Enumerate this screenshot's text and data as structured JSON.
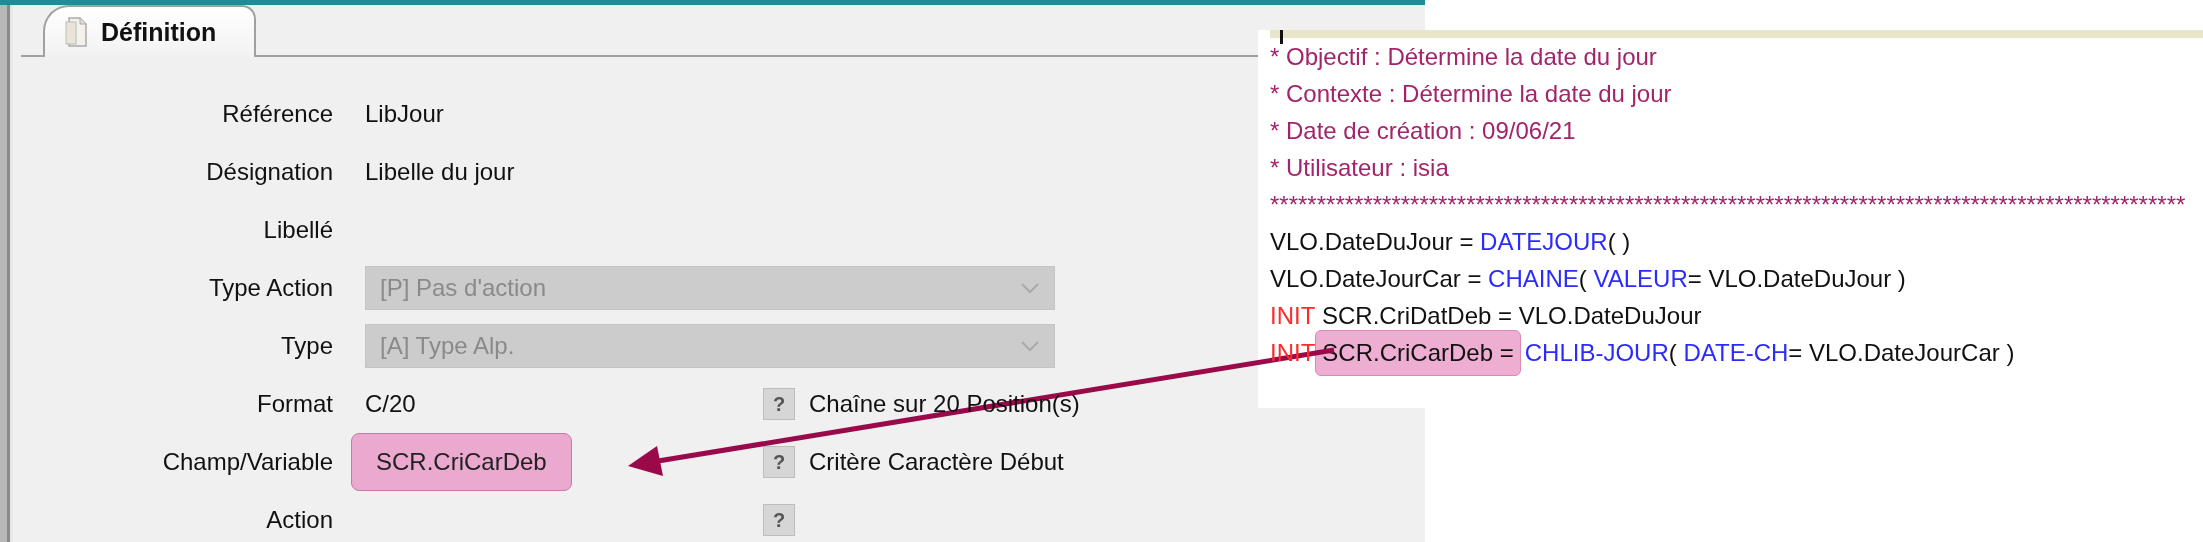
{
  "tab": {
    "label": "Définition",
    "selected": true
  },
  "form": [
    {
      "label": "Référence",
      "kind": "text",
      "value": "LibJour"
    },
    {
      "label": "Désignation",
      "kind": "text",
      "value": "Libelle du jour"
    },
    {
      "label": "Libellé",
      "kind": "text"
    },
    {
      "label": "Type Action",
      "kind": "dropdown",
      "value": "[P] Pas d'action",
      "disabled": true
    },
    {
      "label": "Type",
      "kind": "dropdown",
      "value": "[A] Type Alp.",
      "disabled": true
    },
    {
      "label": "Format",
      "kind": "text",
      "value": "C/20",
      "help": {
        "icon": "?",
        "text": "Chaîne sur 20 Position(s)"
      }
    },
    {
      "label": "Champ/Variable",
      "kind": "text",
      "value": "SCR.CriCarDeb",
      "highlighted": true,
      "help": {
        "icon": "?",
        "text": "Critère Caractère Début"
      }
    },
    {
      "label": "Action",
      "kind": "text",
      "help": {
        "icon": "?"
      }
    }
  ],
  "code": [
    [
      {
        "kind": "comment",
        "text": "* Objectif : Détermine la date du jour"
      }
    ],
    [
      {
        "kind": "comment",
        "text": "* Contexte : Détermine la date du jour"
      }
    ],
    [
      {
        "kind": "comment",
        "text": "* Date de création : 09/06/21"
      }
    ],
    [
      {
        "kind": "comment",
        "text": "* Utilisateur : isia"
      }
    ],
    [
      {
        "kind": "comment",
        "text": "**************************************************************************************************"
      }
    ],
    [
      {
        "kind": "plain",
        "text": "VLO.DateDuJour = "
      },
      {
        "kind": "function",
        "text": "DATEJOUR"
      },
      {
        "kind": "plain",
        "text": "( )"
      }
    ],
    [
      {
        "kind": "plain",
        "text": "VLO.DateJourCar = "
      },
      {
        "kind": "function",
        "text": "CHAINE"
      },
      {
        "kind": "plain",
        "text": "( "
      },
      {
        "kind": "function",
        "text": "VALEUR"
      },
      {
        "kind": "plain",
        "text": "= VLO.DateDuJour )"
      }
    ],
    [
      {
        "kind": "keyword",
        "text": "INIT"
      },
      {
        "kind": "plain",
        "text": " SCR.CriDatDeb = VLO.DateDuJour"
      }
    ],
    [
      {
        "kind": "keyword",
        "text": "INIT"
      },
      {
        "kind": "plain",
        "text": "SCR.CriCarDeb =",
        "highlighted": true
      },
      {
        "kind": "function",
        "text": "CHLIB-JOUR"
      },
      {
        "kind": "plain",
        "text": "( "
      },
      {
        "kind": "function",
        "text": "DATE-CH"
      },
      {
        "kind": "plain",
        "text": "= VLO.DateJourCar )"
      }
    ]
  ]
}
